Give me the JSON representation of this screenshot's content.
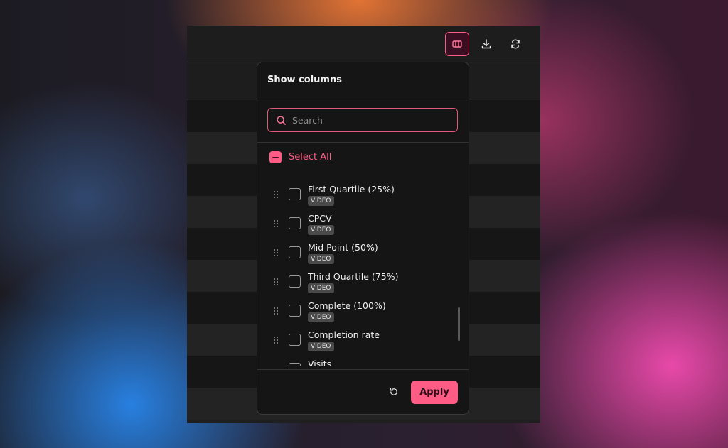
{
  "toolbar": {
    "buttons": [
      {
        "icon": "columns-icon",
        "active": true
      },
      {
        "icon": "download-icon",
        "active": false
      },
      {
        "icon": "refresh-icon",
        "active": false
      }
    ]
  },
  "popover": {
    "title": "Show columns",
    "search": {
      "placeholder": "Search",
      "value": ""
    },
    "select_all": {
      "label": "Select All",
      "state": "indeterminate"
    },
    "columns": [
      {
        "label": "First Quartile (25%)",
        "badge": "VIDEO",
        "checked": false
      },
      {
        "label": "CPCV",
        "badge": "VIDEO",
        "checked": false
      },
      {
        "label": "Mid Point (50%)",
        "badge": "VIDEO",
        "checked": false
      },
      {
        "label": "Third Quartile (75%)",
        "badge": "VIDEO",
        "checked": false
      },
      {
        "label": "Complete (100%)",
        "badge": "VIDEO",
        "checked": false
      },
      {
        "label": "Completion rate",
        "badge": "VIDEO",
        "checked": false
      },
      {
        "label": "Visits",
        "badge": "",
        "checked": false
      }
    ],
    "footer": {
      "reset_icon": "reset-icon",
      "apply_label": "Apply"
    }
  },
  "colors": {
    "accent": "#ff5c85",
    "accent_dark": "#3a0f22",
    "panel_bg": "#151515",
    "app_bg": "#1f1f1f"
  }
}
